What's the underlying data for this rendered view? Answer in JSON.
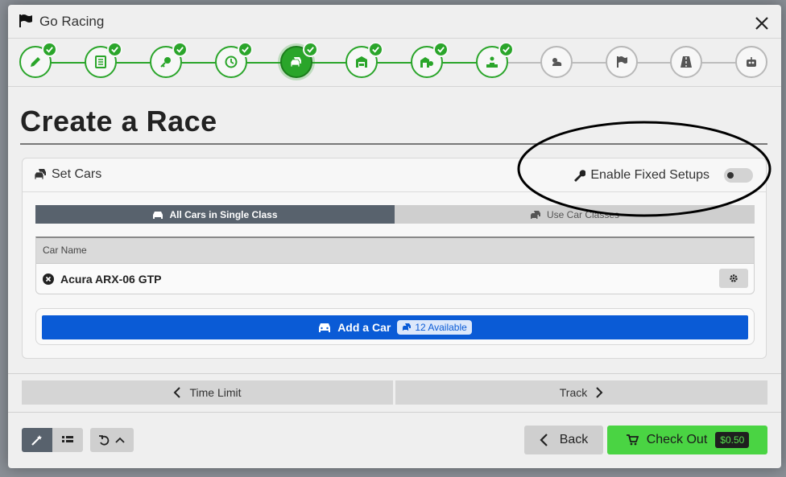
{
  "window": {
    "title": "Go Racing",
    "icon": "flag-icon",
    "close_icon": "close-icon"
  },
  "steps": [
    {
      "icon": "pencil-icon",
      "state": "completed"
    },
    {
      "icon": "list-icon",
      "state": "completed"
    },
    {
      "icon": "key-icon",
      "state": "completed"
    },
    {
      "icon": "clock-icon",
      "state": "completed"
    },
    {
      "icon": "cars-icon",
      "state": "active"
    },
    {
      "icon": "garage-icon",
      "state": "completed"
    },
    {
      "icon": "garage-gear-icon",
      "state": "completed"
    },
    {
      "icon": "podium-icon",
      "state": "completed"
    },
    {
      "icon": "weather-icon",
      "state": "pending"
    },
    {
      "icon": "flag-icon",
      "state": "pending"
    },
    {
      "icon": "road-icon",
      "state": "pending"
    },
    {
      "icon": "robot-icon",
      "state": "pending"
    }
  ],
  "page": {
    "title": "Create a Race"
  },
  "set_cars": {
    "title": "Set Cars",
    "fixed_setups_label": "Enable Fixed Setups",
    "fixed_setups_enabled": false,
    "mode_single": "All Cars in Single Class",
    "mode_classes": "Use Car Classes",
    "table_header": "Car Name",
    "cars": [
      {
        "name": "Acura ARX-06 GTP"
      }
    ],
    "add_car_label": "Add a Car",
    "available_label": "12 Available"
  },
  "nav": {
    "prev_label": "Time Limit",
    "next_label": "Track"
  },
  "footer": {
    "back_label": "Back",
    "checkout_label": "Check Out",
    "price": "$0.50"
  },
  "colors": {
    "accent_green": "#2aa52a",
    "primary_blue": "#0a5bd6",
    "checkout_green": "#4ad443",
    "segment_dark": "#58626d"
  }
}
